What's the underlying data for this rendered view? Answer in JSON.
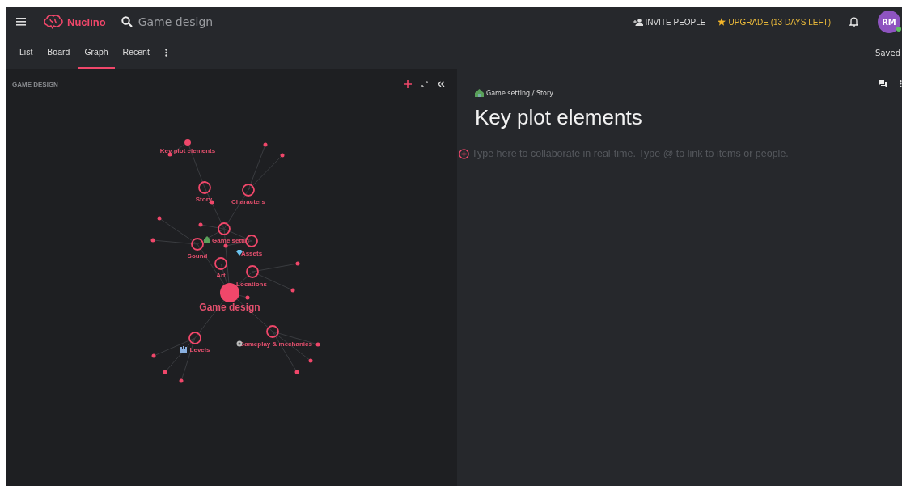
{
  "header": {
    "app_name": "Nuclino",
    "search": {
      "value": "Game design"
    },
    "invite": "INVITE PEOPLE",
    "upgrade": "UPGRADE (13 DAYS LEFT)",
    "avatar": {
      "initials": "RM",
      "online": true
    }
  },
  "tabs": [
    {
      "label": "List",
      "selected": false
    },
    {
      "label": "Board",
      "selected": false
    },
    {
      "label": "Graph",
      "selected": true
    },
    {
      "label": "Recent",
      "selected": false
    }
  ],
  "save_status": "Saved",
  "graph": {
    "title": "GAME DESIGN",
    "nodes": [
      {
        "label": "Game design",
        "kind": "root"
      },
      {
        "label": "Key plot elements",
        "kind": "leaf"
      },
      {
        "label": "Story",
        "kind": "cluster"
      },
      {
        "label": "Characters",
        "kind": "cluster"
      },
      {
        "label": "Game settin",
        "kind": "cluster"
      },
      {
        "label": "Sound",
        "kind": "cluster"
      },
      {
        "label": "Assets",
        "kind": "cluster"
      },
      {
        "label": "Art",
        "kind": "cluster"
      },
      {
        "label": "Locations",
        "kind": "cluster"
      },
      {
        "label": "Levels",
        "kind": "cluster"
      },
      {
        "label": "Gameplay & mechanics",
        "kind": "cluster"
      }
    ]
  },
  "document": {
    "breadcrumb": "Game setting / Story",
    "title": "Key plot elements",
    "placeholder": "Type here to collaborate in real-time. Type @ to link to items or people."
  }
}
